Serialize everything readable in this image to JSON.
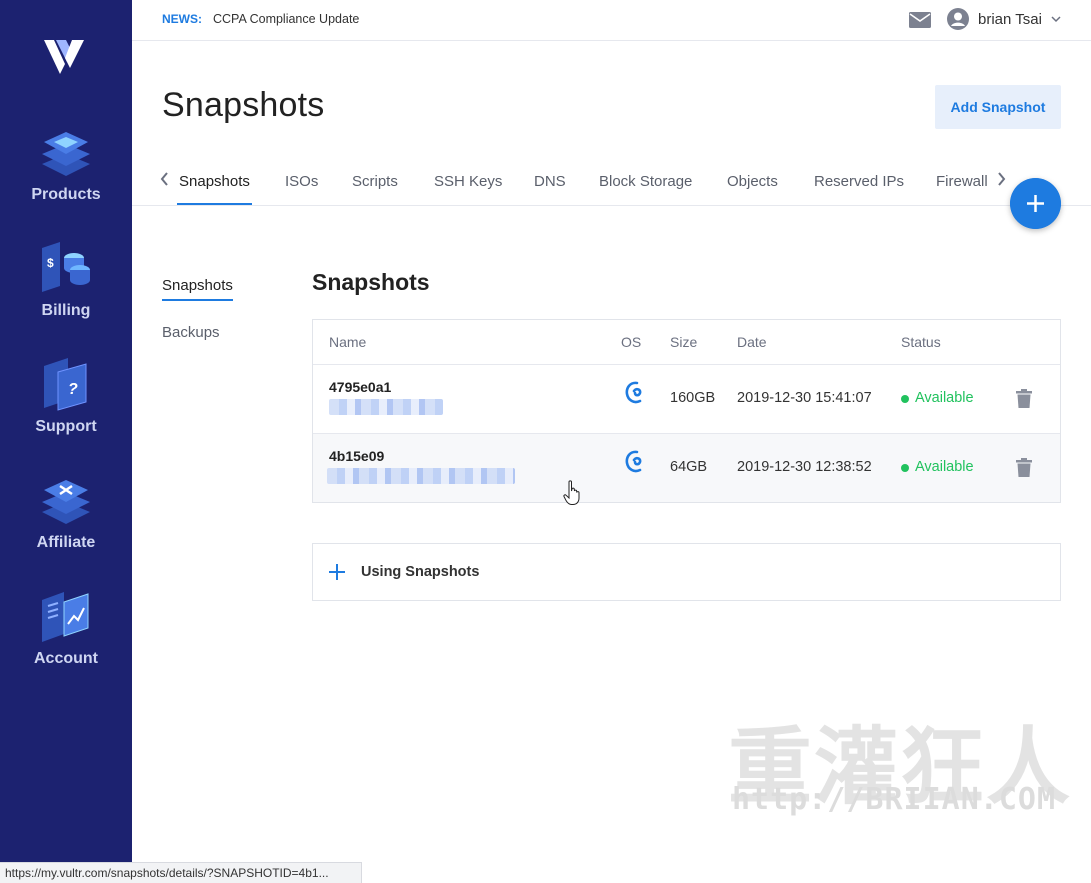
{
  "sidebar": {
    "items": [
      {
        "label": "Products",
        "icon": "products-icon"
      },
      {
        "label": "Billing",
        "icon": "billing-icon"
      },
      {
        "label": "Support",
        "icon": "support-icon"
      },
      {
        "label": "Affiliate",
        "icon": "affiliate-icon"
      },
      {
        "label": "Account",
        "icon": "account-icon"
      }
    ]
  },
  "topbar": {
    "news_label": "NEWS:",
    "news_text": "CCPA Compliance Update",
    "user_name": "brian Tsai"
  },
  "header": {
    "title": "Snapshots",
    "add_button": "Add Snapshot"
  },
  "tabs": [
    "Snapshots",
    "ISOs",
    "Scripts",
    "SSH Keys",
    "DNS",
    "Block Storage",
    "Objects",
    "Reserved IPs",
    "Firewall"
  ],
  "subnav": [
    "Snapshots",
    "Backups"
  ],
  "section_title": "Snapshots",
  "table": {
    "columns": [
      "Name",
      "OS",
      "Size",
      "Date",
      "Status"
    ],
    "rows": [
      {
        "name": "4795e0a1",
        "os": "debian-icon",
        "size": "160GB",
        "date": "2019-12-30 15:41:07",
        "status": "Available"
      },
      {
        "name": "4b15e09",
        "os": "debian-icon",
        "size": "64GB",
        "date": "2019-12-30 12:38:52",
        "status": "Available"
      }
    ]
  },
  "using": {
    "label": "Using Snapshots"
  },
  "watermark": {
    "title": "重灌狂人",
    "url": "http://BRIIAN.COM"
  },
  "status_url": "https://my.vultr.com/snapshots/details/?SNAPSHOTID=4b1...",
  "colors": {
    "sidebar": "#1c2270",
    "accent": "#1e7be0",
    "status_available": "#21c25e"
  }
}
